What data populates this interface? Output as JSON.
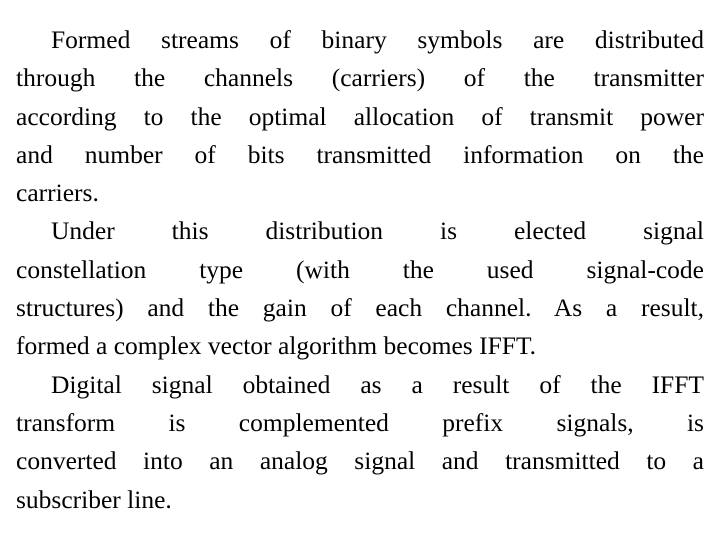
{
  "paragraphs": [
    {
      "lines": [
        "Formed streams of binary symbols are distributed",
        "through the channels (carriers) of the transmitter",
        "according to the optimal allocation of transmit power",
        "and number of bits transmitted information on the",
        "carriers."
      ]
    },
    {
      "lines": [
        "Under this distribution is elected signal",
        "constellation type (with the used signal-code",
        "structures) and the gain of each channel. As a result,",
        "formed a complex vector algorithm becomes IFFT."
      ]
    },
    {
      "lines": [
        "Digital signal obtained as a result of the IFFT",
        "transform is complemented prefix signals, is",
        "converted into an analog signal and transmitted to a",
        "subscriber line."
      ]
    }
  ]
}
